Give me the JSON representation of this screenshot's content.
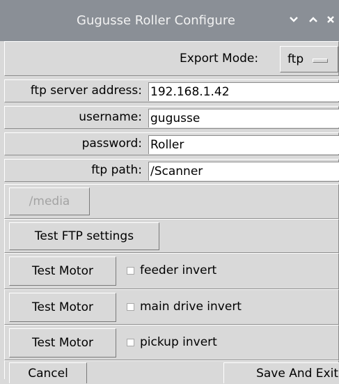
{
  "window": {
    "title": "Gugusse Roller Configure",
    "controls": {
      "minimize": "⌄",
      "maximize": "⌃",
      "close": "×"
    }
  },
  "export_mode": {
    "label": "Export Mode:",
    "value": "ftp",
    "menu_icon": "option-menu-indicator-icon"
  },
  "fields": [
    {
      "label": "ftp server address:",
      "value": "192.168.1.42"
    },
    {
      "label": "username:",
      "value": "gugusse"
    },
    {
      "label": "password:",
      "value": "Roller"
    },
    {
      "label": "ftp path:",
      "value": "/Scanner"
    }
  ],
  "media_button": {
    "label": "/media",
    "enabled": false
  },
  "test_ftp_button": {
    "label": "Test FTP settings"
  },
  "motors": [
    {
      "button": "Test Motor",
      "check_label": "feeder invert",
      "checked": false
    },
    {
      "button": "Test Motor",
      "check_label": "main drive invert",
      "checked": false
    },
    {
      "button": "Test Motor",
      "check_label": "pickup invert",
      "checked": false
    }
  ],
  "footer": {
    "cancel": "Cancel",
    "save": "Save And Exit"
  },
  "colors": {
    "titlebar": "#8a8f96",
    "background": "#d9d9d9",
    "entry": "#ffffff",
    "disabled_text": "#a3a3a3"
  }
}
